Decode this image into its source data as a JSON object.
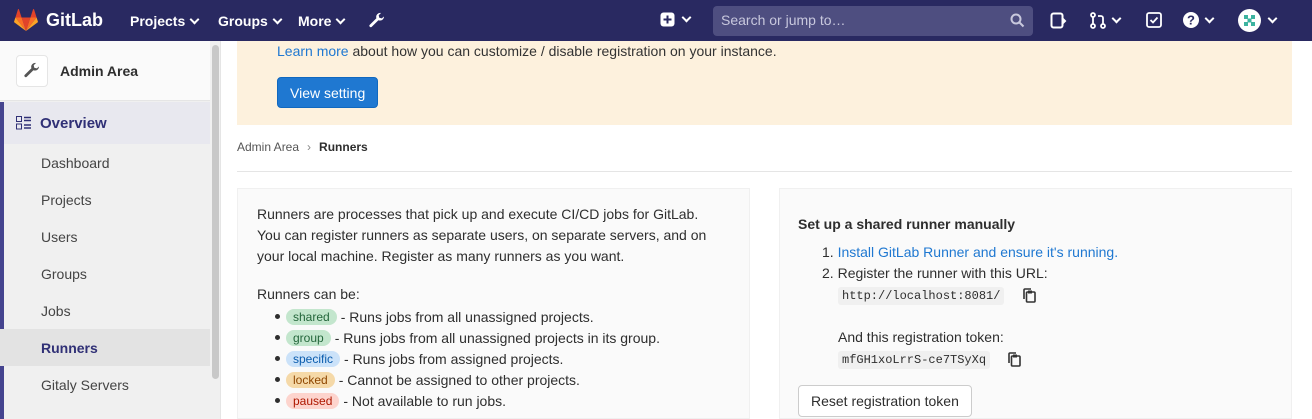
{
  "topbar": {
    "logo_text": "GitLab",
    "nav": [
      "Projects",
      "Groups",
      "More"
    ],
    "search_placeholder": "Search or jump to…"
  },
  "sidebar": {
    "title": "Admin Area",
    "overview_label": "Overview",
    "items": [
      {
        "label": "Dashboard"
      },
      {
        "label": "Projects"
      },
      {
        "label": "Users"
      },
      {
        "label": "Groups"
      },
      {
        "label": "Jobs"
      },
      {
        "label": "Runners"
      },
      {
        "label": "Gitaly Servers"
      }
    ]
  },
  "banner": {
    "link_text": "Learn more",
    "text": " about how you can customize / disable registration on your instance.",
    "button_label": "View setting"
  },
  "breadcrumb": {
    "parent": "Admin Area",
    "current": "Runners"
  },
  "left_panel": {
    "intro_lines": [
      "Runners are processes that pick up and execute CI/CD jobs for GitLab.",
      "You can register runners as separate users, on separate servers, and on",
      "your local machine. Register as many runners as you want."
    ],
    "can_be": "Runners can be:",
    "types": [
      {
        "badge": "shared",
        "desc": " - Runs jobs from all unassigned projects."
      },
      {
        "badge": "group",
        "desc": " - Runs jobs from all unassigned projects in its group."
      },
      {
        "badge": "specific",
        "desc": " - Runs jobs from assigned projects."
      },
      {
        "badge": "locked",
        "desc": " - Cannot be assigned to other projects."
      },
      {
        "badge": "paused",
        "desc": " - Not available to run jobs."
      }
    ]
  },
  "right_panel": {
    "title": "Set up a shared runner manually",
    "step1_num": "1.",
    "step1_link": "Install GitLab Runner and ensure it's running.",
    "step2_num": "2.",
    "step2_text": "Register the runner with this URL:",
    "url": "http://localhost:8081/",
    "token_label": "And this registration token:",
    "token": "mfGH1xoLrrS-ce7TSyXq",
    "reset_label": "Reset registration token"
  },
  "colors": {
    "topbar": "#292961",
    "accent": "#45448f",
    "link": "#1f78d1",
    "banner": "#fdf1dd"
  }
}
